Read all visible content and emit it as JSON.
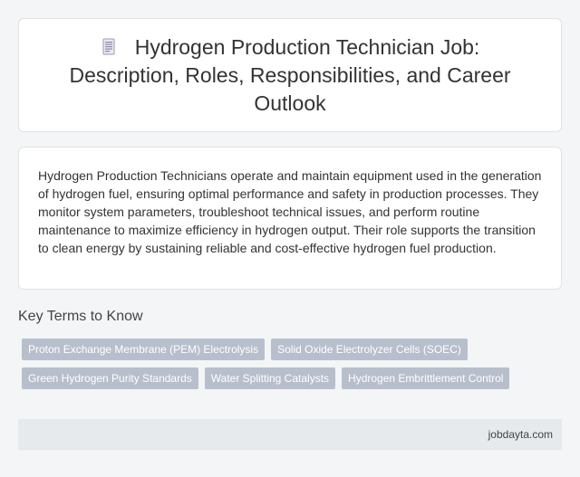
{
  "header": {
    "icon": "document-icon",
    "title": "Hydrogen Production Technician Job: Description, Roles, Responsibilities, and Career Outlook"
  },
  "description": {
    "text": "Hydrogen Production Technicians operate and maintain equipment used in the generation of hydrogen fuel, ensuring optimal performance and safety in production processes. They monitor system parameters, troubleshoot technical issues, and perform routine maintenance to maximize efficiency in hydrogen output. Their role supports the transition to clean energy by sustaining reliable and cost-effective hydrogen fuel production."
  },
  "key_terms": {
    "heading": "Key Terms to Know",
    "items": [
      "Proton Exchange Membrane (PEM) Electrolysis",
      "Solid Oxide Electrolyzer Cells (SOEC)",
      "Green Hydrogen Purity Standards",
      "Water Splitting Catalysts",
      "Hydrogen Embrittlement Control"
    ]
  },
  "footer": {
    "site": "jobdayta.com"
  },
  "colors": {
    "background": "#f3f5f6",
    "card": "#ffffff",
    "tag": "#b8bfcc",
    "footer": "#e6eaec"
  }
}
